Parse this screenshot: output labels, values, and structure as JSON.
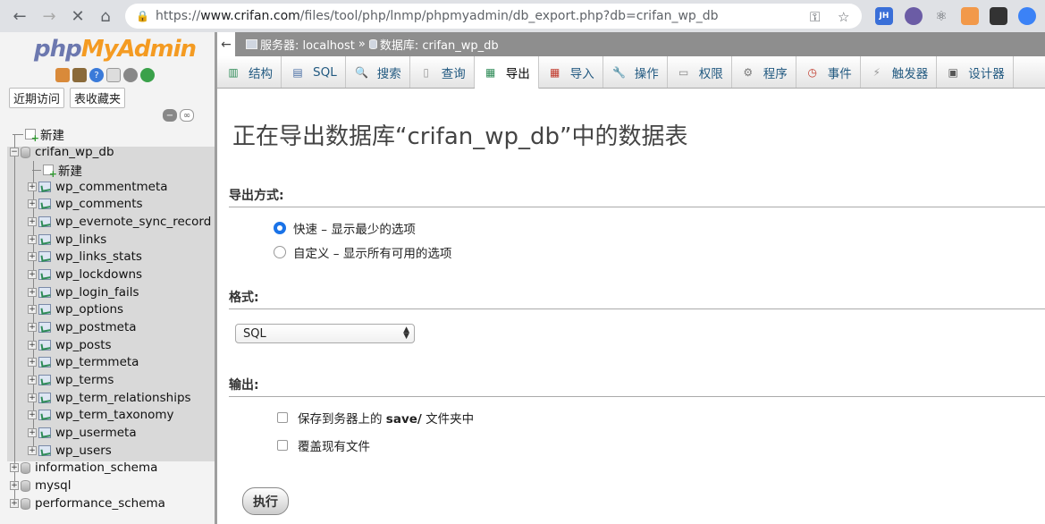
{
  "browser": {
    "url_scheme": "https://",
    "url_host": "www.crifan.com",
    "url_path": "/files/tool/php/lnmp/phpmyadmin/db_export.php?db=crifan_wp_db",
    "extensions": [
      "JH",
      "ext",
      "react",
      "ext",
      "qr",
      "ext"
    ]
  },
  "leftnav": {
    "logo_a": "php",
    "logo_b": "MyAdmin",
    "tabs": [
      "近期访问",
      "表收藏夹"
    ],
    "tree": {
      "new_root": "新建",
      "current_db": "crifan_wp_db",
      "new_table": "新建",
      "tables": [
        "wp_commentmeta",
        "wp_comments",
        "wp_evernote_sync_record",
        "wp_links",
        "wp_links_stats",
        "wp_lockdowns",
        "wp_login_fails",
        "wp_options",
        "wp_postmeta",
        "wp_posts",
        "wp_termmeta",
        "wp_terms",
        "wp_term_relationships",
        "wp_term_taxonomy",
        "wp_usermeta",
        "wp_users"
      ],
      "other_dbs": [
        "information_schema",
        "mysql",
        "performance_schema"
      ]
    }
  },
  "breadcrumb": {
    "server": "服务器: localhost",
    "sep": "»",
    "database": "数据库: crifan_wp_db"
  },
  "tabs": [
    {
      "label": "结构",
      "icon": "structure-icon"
    },
    {
      "label": "SQL",
      "icon": "sql-icon"
    },
    {
      "label": "搜索",
      "icon": "search-icon"
    },
    {
      "label": "查询",
      "icon": "query-icon"
    },
    {
      "label": "导出",
      "icon": "export-icon"
    },
    {
      "label": "导入",
      "icon": "import-icon"
    },
    {
      "label": "操作",
      "icon": "wrench-icon"
    },
    {
      "label": "权限",
      "icon": "privileges-icon"
    },
    {
      "label": "程序",
      "icon": "routines-icon"
    },
    {
      "label": "事件",
      "icon": "events-icon"
    },
    {
      "label": "触发器",
      "icon": "triggers-icon"
    },
    {
      "label": "设计器",
      "icon": "designer-icon"
    }
  ],
  "main": {
    "title": "正在导出数据库“crifan_wp_db”中的数据表",
    "method_heading": "导出方式:",
    "method_quick": "快速 – 显示最少的选项",
    "method_custom": "自定义 – 显示所有可用的选项",
    "format_heading": "格式:",
    "format_value": "SQL",
    "output_heading": "输出:",
    "save_on_server_a": "保存到务器上的 ",
    "save_on_server_b": "save/",
    "save_on_server_c": " 文件夹中",
    "overwrite": "覆盖现有文件",
    "go": "执行"
  }
}
